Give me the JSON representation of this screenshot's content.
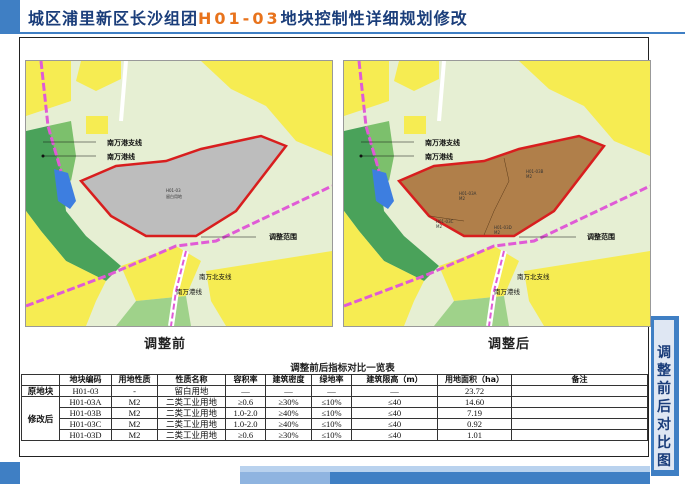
{
  "header": {
    "title_prefix": "城区浦里新区长沙组团",
    "title_code": "H01-03",
    "title_suffix": "地块控制性详细规划修改"
  },
  "maps": {
    "before": {
      "caption": "调整前",
      "labels": {
        "line1": "南万港支线",
        "line2": "南万港线",
        "range": "调整范围",
        "road1": "南万北支线",
        "road2": "南万港线",
        "parcel_code": "H01-03",
        "parcel_use": "留白用地"
      }
    },
    "after": {
      "caption": "调整后",
      "labels": {
        "line1": "南万港支线",
        "line2": "南万港线",
        "range": "调整范围",
        "road1": "南万北支线",
        "road2": "南万港线",
        "parcel_a": "H01-03A",
        "parcel_b": "H01-03B",
        "parcel_c": "H01-03C",
        "parcel_d": "H01-03D",
        "use": "M2"
      }
    },
    "colors": {
      "base": "#e6efd3",
      "residential": "#f6ec52",
      "green": "#4aa25a",
      "water": "#3d7ee0",
      "reserve": "#bdbdbd",
      "industrial": "#b07f4a",
      "boundary": "#d81e1e",
      "road": "#e05bd6"
    }
  },
  "table": {
    "title": "调整前后指标对比一览表",
    "headers": [
      "地块编码",
      "用地性质",
      "性质名称",
      "容积率",
      "建筑密度",
      "绿地率",
      "建筑限高（m）",
      "用地面积（ha）",
      "备注"
    ],
    "groups": [
      {
        "name": "原地块",
        "rows": [
          [
            "H01-03",
            "-",
            "留白用地",
            "—",
            "—",
            "—",
            "—",
            "23.72",
            ""
          ]
        ]
      },
      {
        "name": "修改后",
        "rows": [
          [
            "H01-03A",
            "M2",
            "二类工业用地",
            "≥0.6",
            "≥30%",
            "≤10%",
            "≤40",
            "14.60",
            ""
          ],
          [
            "H01-03B",
            "M2",
            "二类工业用地",
            "1.0-2.0",
            "≥40%",
            "≤10%",
            "≤40",
            "7.19",
            ""
          ],
          [
            "H01-03C",
            "M2",
            "二类工业用地",
            "1.0-2.0",
            "≥40%",
            "≤10%",
            "≤40",
            "0.92",
            ""
          ],
          [
            "H01-03D",
            "M2",
            "二类工业用地",
            "≥0.6",
            "≥30%",
            "≤10%",
            "≤40",
            "1.01",
            ""
          ]
        ]
      }
    ]
  },
  "side_tab": {
    "text": "调整前后对比图"
  }
}
